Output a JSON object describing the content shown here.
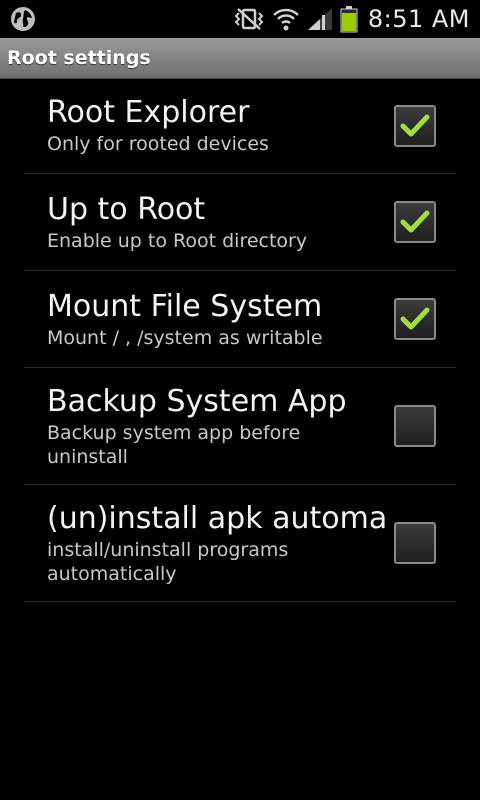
{
  "status_bar": {
    "time": "8:51 AM",
    "icons": [
      "globe-icon",
      "vibrate-mute-icon",
      "wifi-icon",
      "signal-icon",
      "battery-icon"
    ],
    "battery_color": "#99cc00"
  },
  "title_bar": {
    "title": "Root settings"
  },
  "settings": [
    {
      "title": "Root Explorer",
      "summary": "Only for rooted devices",
      "checked": true
    },
    {
      "title": "Up to Root",
      "summary": "Enable up to Root directory",
      "checked": true
    },
    {
      "title": "Mount File System",
      "summary": "Mount / , /system as writable",
      "checked": true
    },
    {
      "title": "Backup System App",
      "summary": "Backup system app before uninstall",
      "checked": false
    },
    {
      "title": "(un)install apk automa",
      "summary": "install/uninstall programs automatically",
      "checked": false
    }
  ],
  "colors": {
    "check_mark": "#9fe040",
    "title_bar_top": "#9a9a9a",
    "title_bar_bottom": "#6f6f6f",
    "background": "#000000"
  }
}
